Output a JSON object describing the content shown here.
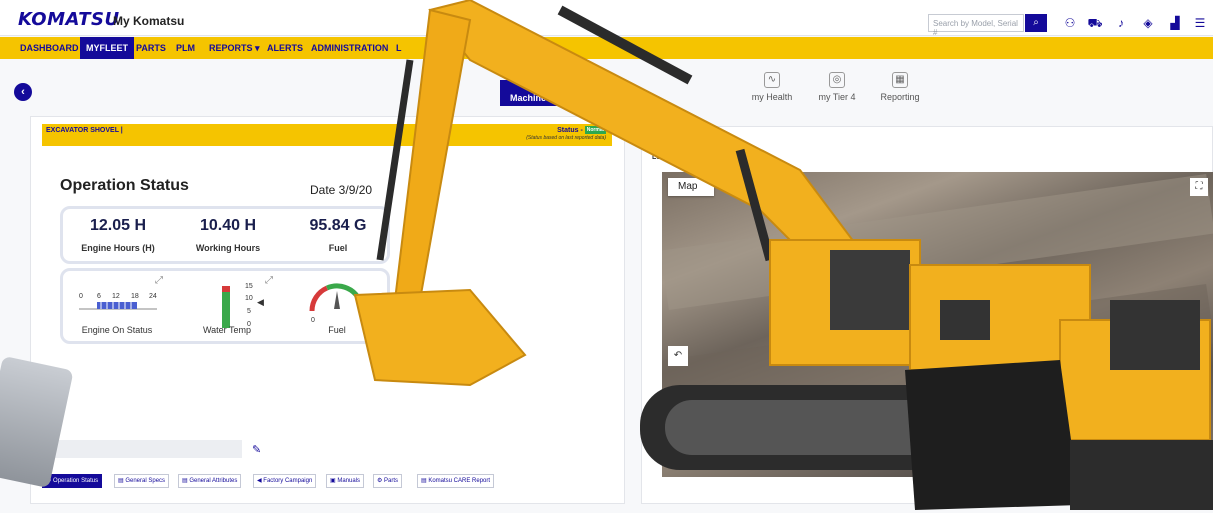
{
  "header": {
    "logo": "KOMATSU",
    "app_title": "My Komatsu",
    "search_placeholder": "Search by Model, Serial #",
    "icons": [
      "search-icon",
      "user-icon",
      "cart-icon",
      "bell-icon",
      "tag-icon",
      "chart-icon",
      "menu-icon"
    ]
  },
  "nav": {
    "items": [
      {
        "label": "DASHBOARD"
      },
      {
        "label": "MYFLEET"
      },
      {
        "label": "PARTS"
      },
      {
        "label": "PLM"
      },
      {
        "label": "REPORTS ▾"
      },
      {
        "label": "ALERTS"
      },
      {
        "label": "ADMINISTRATION"
      },
      {
        "label": "L"
      }
    ],
    "active": "MYFLEET"
  },
  "tabs": {
    "machine": "Machine D",
    "right": [
      {
        "label": "my Health",
        "icon": "health-icon"
      },
      {
        "label": "my Tier 4",
        "icon": "tier4-icon"
      },
      {
        "label": "Reporting",
        "icon": "reporting-icon"
      }
    ]
  },
  "machine_bar": {
    "title": "EXCAVATOR SHOVEL |",
    "status_label": "Status -",
    "status_badge": "Normal",
    "status_note": "(Status based on last reported data)"
  },
  "operation": {
    "title": "Operation Status",
    "date": "Date 3/9/20",
    "stats": [
      {
        "value": "12.05 H",
        "label": "Engine Hours (H)"
      },
      {
        "value": "10.40 H",
        "label": "Working Hours"
      },
      {
        "value": "95.84 G",
        "label": "Fuel"
      }
    ],
    "gauges": {
      "engine_on": {
        "label": "Engine On Status",
        "ticks": [
          "0",
          "6",
          "12",
          "18",
          "24"
        ]
      },
      "water_temp": {
        "label": "Water Temp",
        "ticks": [
          "15",
          "10",
          "5",
          "0"
        ]
      },
      "fuel": {
        "label": "Fuel",
        "min": "0"
      }
    }
  },
  "bottom_tabs": [
    {
      "label": "⚙ Operation Status"
    },
    {
      "label": "▤ General Specs"
    },
    {
      "label": "▤ General Attributes"
    },
    {
      "label": "◀ Factory Campaign"
    },
    {
      "label": "▣ Manuals"
    },
    {
      "label": "⚙ Parts"
    },
    {
      "label": "▤ Komatsu CARE Report"
    }
  ],
  "location": {
    "label": "Location",
    "map_button": "Map",
    "fullscreen": "⛶",
    "control": "↶"
  },
  "colors": {
    "brand": "#140a9a",
    "accent": "#f5c400",
    "status_green": "#2ea84f"
  }
}
